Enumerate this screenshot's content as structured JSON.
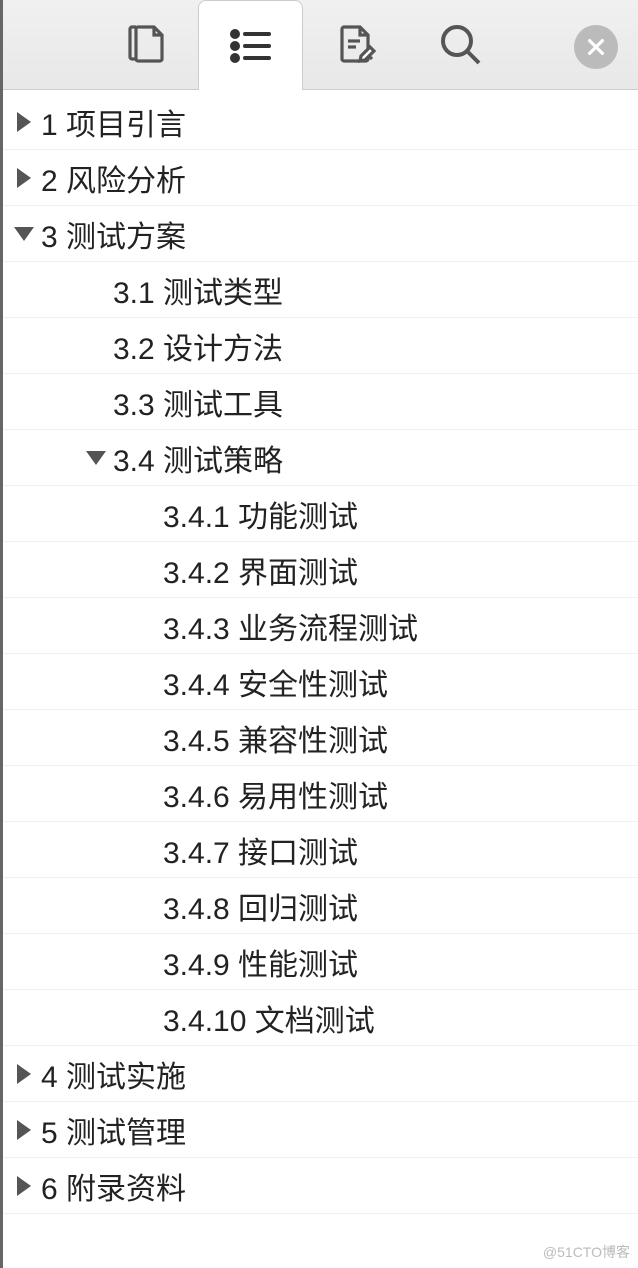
{
  "toolbar": {
    "tabs": [
      {
        "name": "thumbnails",
        "active": false
      },
      {
        "name": "outline",
        "active": true
      },
      {
        "name": "annotations",
        "active": false
      },
      {
        "name": "search",
        "active": false
      }
    ]
  },
  "outline": [
    {
      "label": "1 项目引言",
      "level": 0,
      "expandable": true,
      "expanded": false
    },
    {
      "label": "2 风险分析",
      "level": 0,
      "expandable": true,
      "expanded": false
    },
    {
      "label": "3 测试方案",
      "level": 0,
      "expandable": true,
      "expanded": true
    },
    {
      "label": "3.1 测试类型",
      "level": 1,
      "expandable": false,
      "expanded": false
    },
    {
      "label": "3.2 设计方法",
      "level": 1,
      "expandable": false,
      "expanded": false
    },
    {
      "label": "3.3 测试工具",
      "level": 1,
      "expandable": false,
      "expanded": false
    },
    {
      "label": "3.4 测试策略",
      "level": 1,
      "expandable": true,
      "expanded": true
    },
    {
      "label": "3.4.1 功能测试",
      "level": 2,
      "expandable": false,
      "expanded": false
    },
    {
      "label": "3.4.2 界面测试",
      "level": 2,
      "expandable": false,
      "expanded": false
    },
    {
      "label": "3.4.3 业务流程测试",
      "level": 2,
      "expandable": false,
      "expanded": false
    },
    {
      "label": "3.4.4 安全性测试",
      "level": 2,
      "expandable": false,
      "expanded": false
    },
    {
      "label": "3.4.5 兼容性测试",
      "level": 2,
      "expandable": false,
      "expanded": false
    },
    {
      "label": "3.4.6 易用性测试",
      "level": 2,
      "expandable": false,
      "expanded": false
    },
    {
      "label": "3.4.7 接口测试",
      "level": 2,
      "expandable": false,
      "expanded": false
    },
    {
      "label": "3.4.8 回归测试",
      "level": 2,
      "expandable": false,
      "expanded": false
    },
    {
      "label": "3.4.9 性能测试",
      "level": 2,
      "expandable": false,
      "expanded": false
    },
    {
      "label": "3.4.10 文档测试",
      "level": 2,
      "expandable": false,
      "expanded": false
    },
    {
      "label": "4 测试实施",
      "level": 0,
      "expandable": true,
      "expanded": false
    },
    {
      "label": "5 测试管理",
      "level": 0,
      "expandable": true,
      "expanded": false
    },
    {
      "label": "6 附录资料",
      "level": 0,
      "expandable": true,
      "expanded": false
    }
  ],
  "watermark": "@51CTO博客"
}
